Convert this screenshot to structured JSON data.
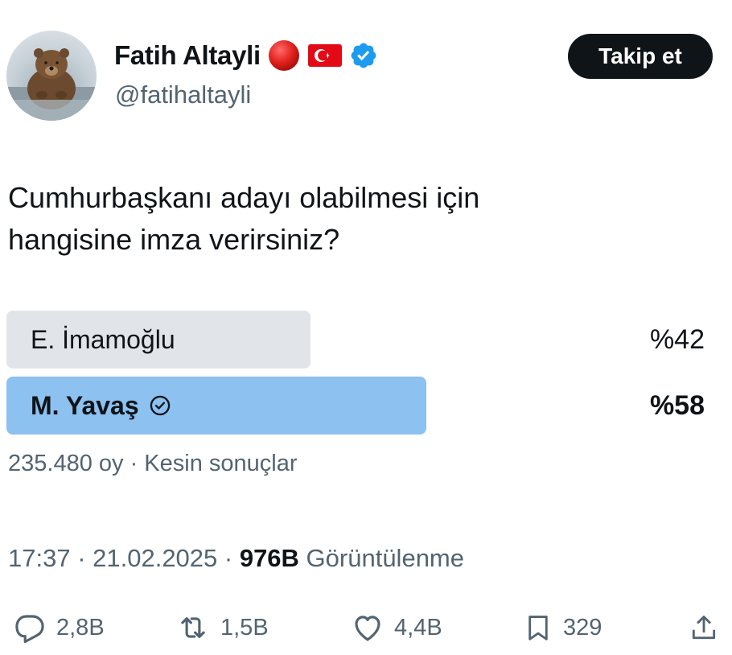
{
  "author": {
    "display_name": "Fatih Altayli",
    "handle": "@fatihaltayli",
    "badges": [
      "red-circle-emoji",
      "turkey-flag-emoji",
      "verified-badge-icon"
    ],
    "verified_color": "#1d9bf0"
  },
  "follow_button": {
    "label": "Takip et"
  },
  "tweet": {
    "lines": [
      "Cumhurbaşkanı adayı olabilmesi için",
      "hangisine imza verirsiniz?"
    ]
  },
  "poll": {
    "options": [
      {
        "label": "E. İmamoğlu",
        "percent_text": "%42",
        "percent": 42,
        "winner": false,
        "color": "#e1e4e8"
      },
      {
        "label": "M. Yavaş",
        "percent_text": "%58",
        "percent": 58,
        "winner": true,
        "color": "#8cc1f0"
      }
    ],
    "meta": "235.480 oy · Kesin sonuçlar"
  },
  "timestamp": {
    "time_date": "17:37 · 21.02.2025 · ",
    "views_count": "976B",
    "views_label": " Görüntülenme"
  },
  "actions": {
    "reply_count": "2,8B",
    "retweet_count": "1,5B",
    "like_count": "4,4B",
    "bookmark_count": "329"
  }
}
